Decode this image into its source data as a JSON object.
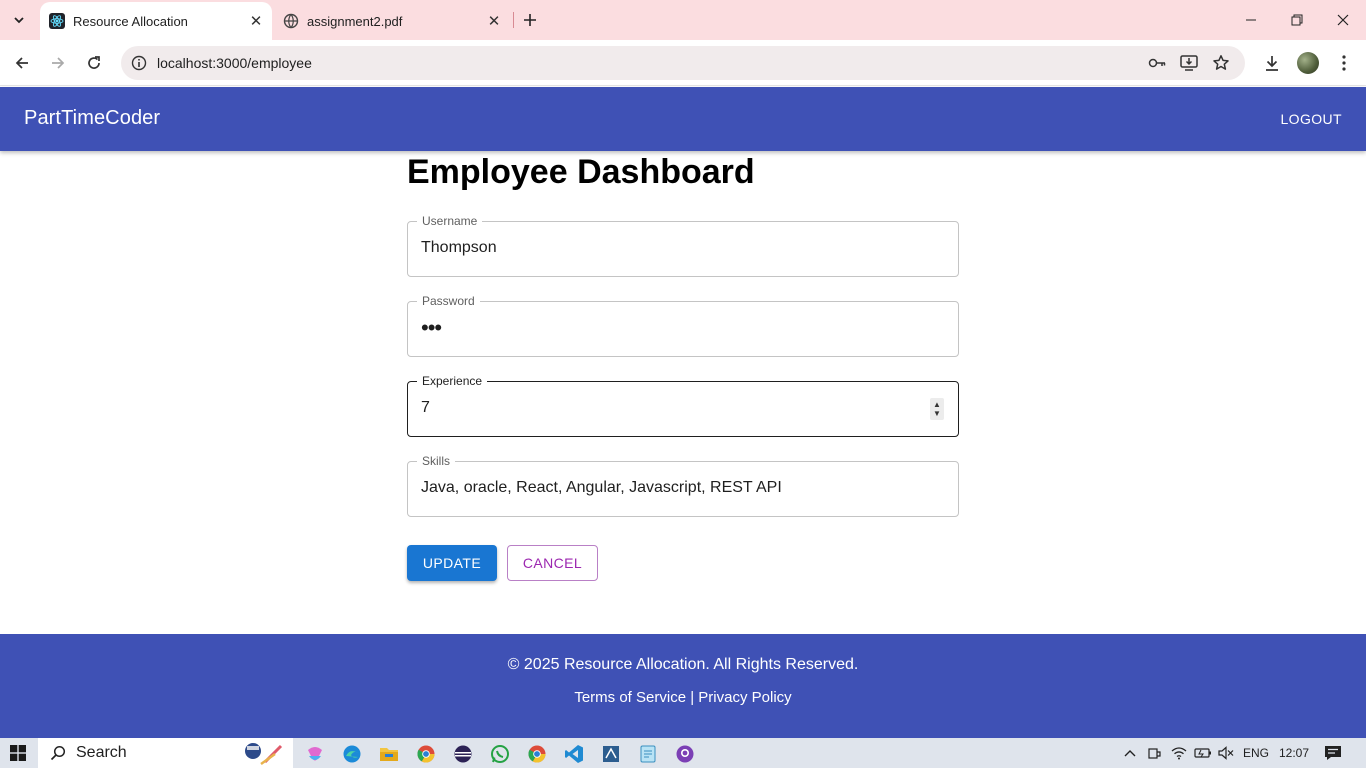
{
  "browser": {
    "tabs": [
      {
        "title": "Resource Allocation",
        "active": true,
        "icon": "react-favicon-icon"
      },
      {
        "title": "assignment2.pdf",
        "active": false,
        "icon": "globe-icon"
      }
    ],
    "url": "localhost:3000/employee"
  },
  "appbar": {
    "brand": "PartTimeCoder",
    "logout_label": "LOGOUT"
  },
  "page": {
    "title": "Employee Dashboard",
    "fields": {
      "username": {
        "label": "Username",
        "value": "Thompson"
      },
      "password": {
        "label": "Password",
        "value": "•••"
      },
      "experience": {
        "label": "Experience",
        "value": "7"
      },
      "skills": {
        "label": "Skills",
        "value": "Java, oracle, React, Angular, Javascript, REST API"
      }
    },
    "update_label": "UPDATE",
    "cancel_label": "CANCEL"
  },
  "footer": {
    "copyright": "© 2025 Resource Allocation. All Rights Reserved.",
    "terms": "Terms of Service",
    "separator": "|",
    "privacy": "Privacy Policy"
  },
  "taskbar": {
    "search_placeholder": "Search",
    "language": "ENG",
    "time": "12:07"
  },
  "colors": {
    "primary": "#3f51b5",
    "button_blue": "#1976d2",
    "secondary_purple": "#9c27b0",
    "tabstrip": "#fbdde0"
  }
}
